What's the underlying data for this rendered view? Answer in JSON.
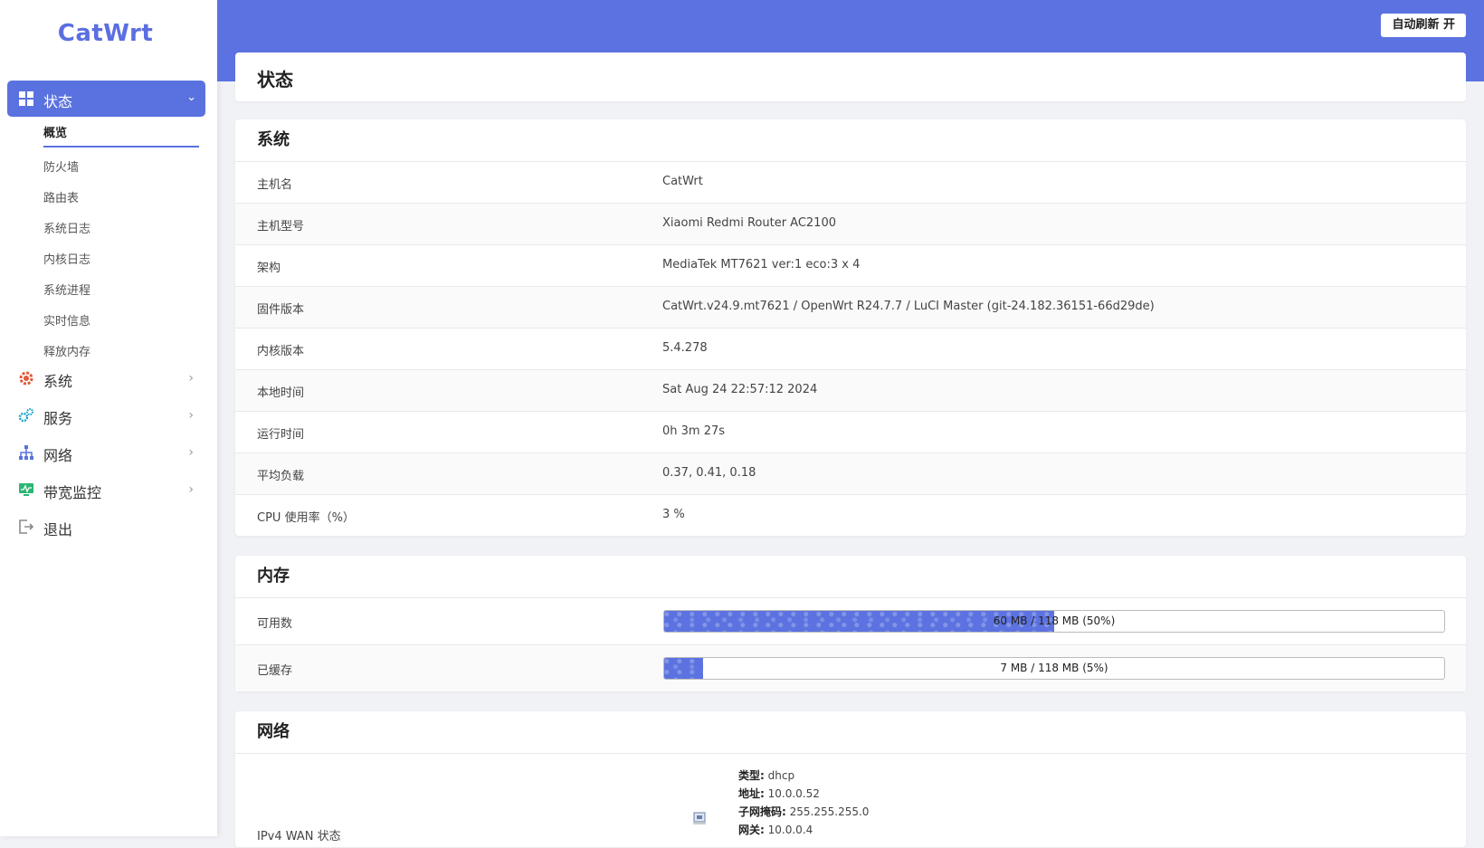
{
  "app": {
    "logo": "CatWrt"
  },
  "sidebar": {
    "active_menu": {
      "label": "状态"
    },
    "submenu": [
      {
        "label": "概览",
        "active": true
      },
      {
        "label": "防火墙"
      },
      {
        "label": "路由表"
      },
      {
        "label": "系统日志"
      },
      {
        "label": "内核日志"
      },
      {
        "label": "系统进程"
      },
      {
        "label": "实时信息"
      },
      {
        "label": "释放内存"
      }
    ],
    "items": [
      {
        "label": "系统",
        "icon": "gear-icon",
        "color": "#e05a3a"
      },
      {
        "label": "服务",
        "icon": "services-icon",
        "color": "#1aa3c9"
      },
      {
        "label": "网络",
        "icon": "network-icon",
        "color": "#5a72e0"
      },
      {
        "label": "带宽监控",
        "icon": "monitor-icon",
        "color": "#2bb673"
      },
      {
        "label": "退出",
        "icon": "logout-icon",
        "color": "#888"
      }
    ]
  },
  "topbar": {
    "refresh_label": "自动刷新 开"
  },
  "page": {
    "title": "状态"
  },
  "system": {
    "title": "系统",
    "rows": [
      {
        "k": "主机名",
        "v": "CatWrt"
      },
      {
        "k": "主机型号",
        "v": "Xiaomi Redmi Router AC2100"
      },
      {
        "k": "架构",
        "v": "MediaTek MT7621 ver:1 eco:3 x 4"
      },
      {
        "k": "固件版本",
        "v": "CatWrt.v24.9.mt7621 / OpenWrt R24.7.7 / LuCI Master (git-24.182.36151-66d29de)"
      },
      {
        "k": "内核版本",
        "v": "5.4.278"
      },
      {
        "k": "本地时间",
        "v": "Sat Aug 24 22:57:12 2024"
      },
      {
        "k": "运行时间",
        "v": "0h 3m 27s"
      },
      {
        "k": "平均负载",
        "v": "0.37, 0.41, 0.18"
      },
      {
        "k": "CPU 使用率（%）",
        "v": "3 %"
      }
    ]
  },
  "memory": {
    "title": "内存",
    "rows": [
      {
        "k": "可用数",
        "text": "60 MB / 118 MB (50%)",
        "percent": 50
      },
      {
        "k": "已缓存",
        "text": "7 MB / 118 MB (5%)",
        "percent": 5
      }
    ]
  },
  "network": {
    "title": "网络",
    "wan_label": "IPv4 WAN 状态",
    "info": [
      {
        "k": "类型:",
        "v": "dhcp"
      },
      {
        "k": "地址:",
        "v": "10.0.0.52"
      },
      {
        "k": "子网掩码:",
        "v": "255.255.255.0"
      },
      {
        "k": "网关:",
        "v": "10.0.0.4"
      }
    ]
  },
  "colors": {
    "accent": "#5b72e0"
  }
}
